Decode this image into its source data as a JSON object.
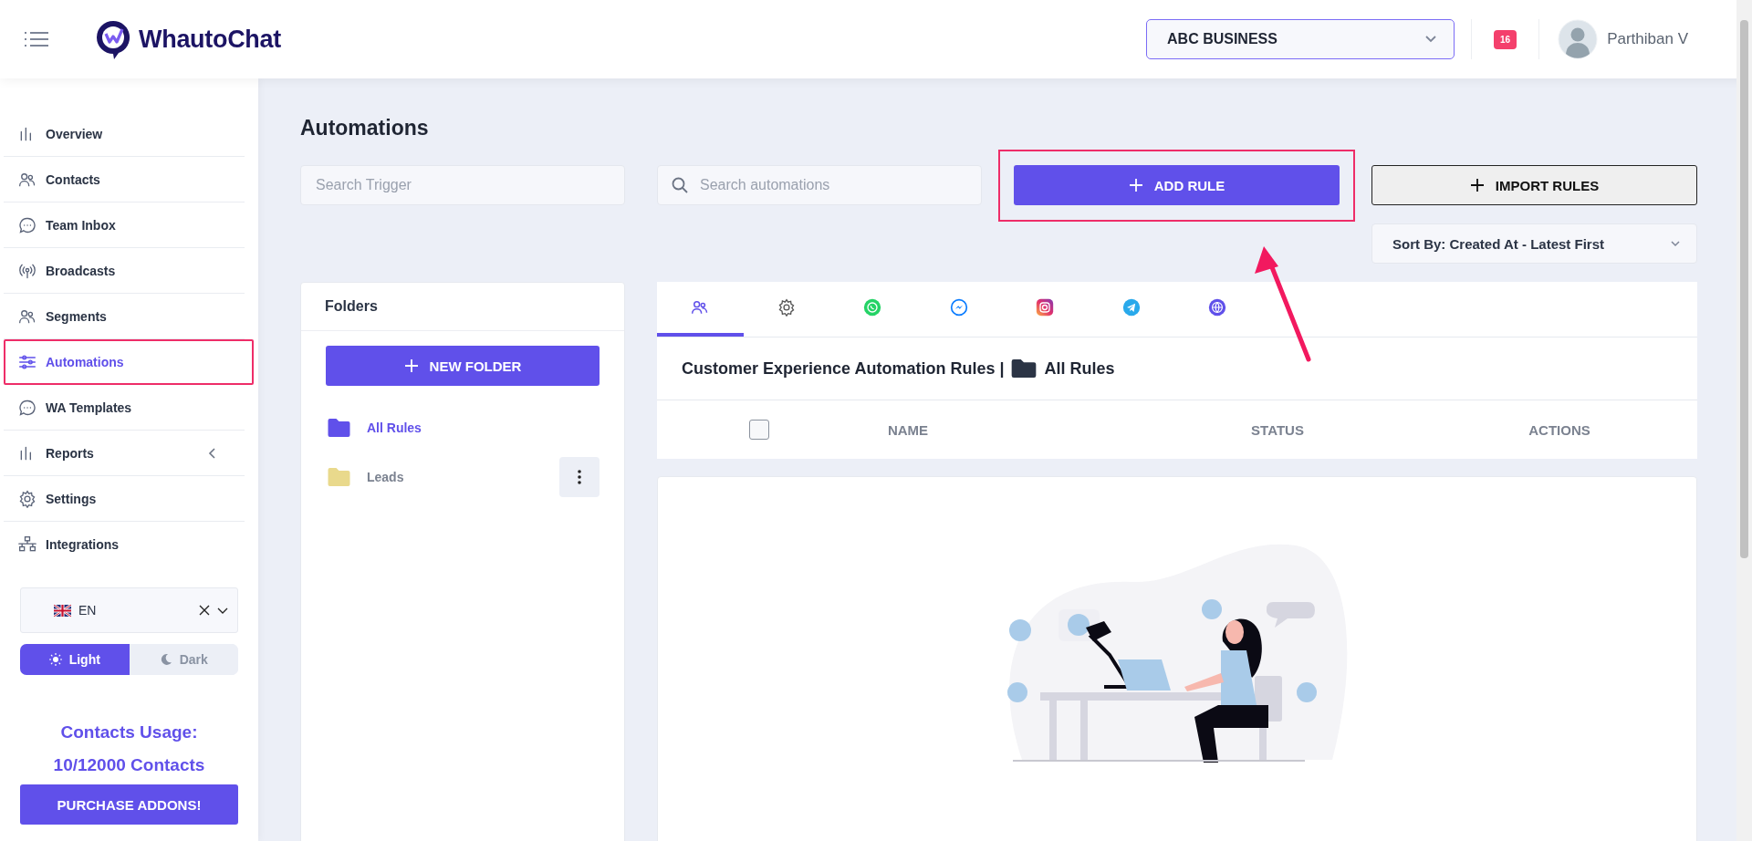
{
  "header": {
    "logo": "WhautoChat",
    "business_select": "ABC BUSINESS",
    "notification_count": "16",
    "user_name": "Parthiban V"
  },
  "sidebar": {
    "items": [
      {
        "label": "Overview",
        "kind": "bars",
        "selected": false,
        "highlighted": false,
        "has_submenu": false
      },
      {
        "label": "Contacts",
        "kind": "people",
        "selected": false,
        "highlighted": false,
        "has_submenu": false
      },
      {
        "label": "Team Inbox",
        "kind": "chat",
        "selected": false,
        "highlighted": false,
        "has_submenu": false
      },
      {
        "label": "Broadcasts",
        "kind": "broadcast",
        "selected": false,
        "highlighted": false,
        "has_submenu": false
      },
      {
        "label": "Segments",
        "kind": "people",
        "selected": false,
        "highlighted": false,
        "has_submenu": false
      },
      {
        "label": "Automations",
        "kind": "sliders",
        "selected": true,
        "highlighted": true,
        "has_submenu": false
      },
      {
        "label": "WA Templates",
        "kind": "chat",
        "selected": false,
        "highlighted": false,
        "has_submenu": false
      },
      {
        "label": "Reports",
        "kind": "bars",
        "selected": false,
        "highlighted": false,
        "has_submenu": true
      },
      {
        "label": "Settings",
        "kind": "gear",
        "selected": false,
        "highlighted": false,
        "has_submenu": false
      },
      {
        "label": "Integrations",
        "kind": "network",
        "selected": false,
        "highlighted": false,
        "has_submenu": false
      }
    ],
    "language": "EN",
    "theme_toggle": [
      {
        "label": "Light",
        "kind": "sun",
        "selected": true
      },
      {
        "label": "Dark",
        "kind": "moon",
        "selected": false
      }
    ],
    "usage_title": "Contacts Usage:",
    "usage_value": "10/12000 Contacts",
    "purchase_button": "PURCHASE ADDONS!"
  },
  "page": {
    "title": "Automations",
    "search_trigger": {
      "placeholder": "Search Trigger"
    },
    "search_automations": {
      "placeholder": "Search automations"
    },
    "add_rule": {
      "label": "ADD RULE",
      "highlighted": true
    },
    "import_rules": "IMPORT RULES",
    "sort_select": "Sort By: Created At - Latest First",
    "folders": {
      "title": "Folders",
      "new_folder": "NEW FOLDER",
      "items": [
        {
          "label": "All Rules",
          "selected": true,
          "color": "#6050ea",
          "has_menu": false
        },
        {
          "label": "Leads",
          "selected": false,
          "color": "#e9d98c",
          "has_menu": true
        }
      ]
    },
    "channel_tabs": [
      {
        "kind": "people",
        "selected": true
      },
      {
        "kind": "gear",
        "selected": false
      },
      {
        "kind": "whatsapp",
        "selected": false
      },
      {
        "kind": "messenger",
        "selected": false
      },
      {
        "kind": "instagram",
        "selected": false
      },
      {
        "kind": "telegram",
        "selected": false
      },
      {
        "kind": "web",
        "selected": false
      }
    ],
    "breadcrumb": {
      "section": "Customer Experience Automation Rules |",
      "folder": "All Rules"
    },
    "table": {
      "select_all": {
        "checked": false
      },
      "columns": [
        "NAME",
        "STATUS",
        "ACTIONS"
      ]
    }
  }
}
